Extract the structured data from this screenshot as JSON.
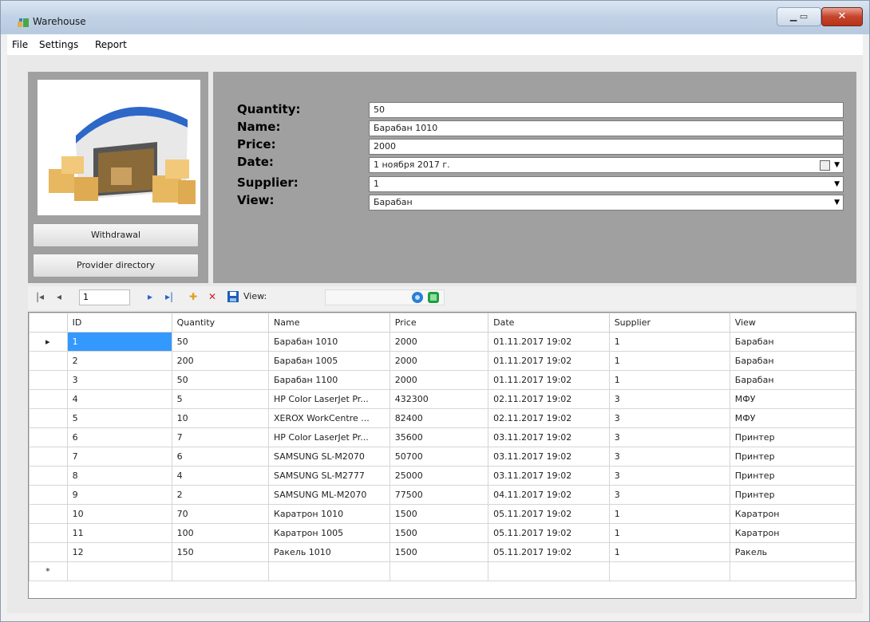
{
  "window": {
    "title": "Warehouse"
  },
  "menu": [
    "File",
    "Settings",
    "Report"
  ],
  "side_buttons": {
    "withdrawal": "Withdrawal",
    "provider_directory": "Provider directory"
  },
  "form": {
    "quantity_label": "Quantity:",
    "quantity_value": "50",
    "name_label": "Name:",
    "name_value": "Барабан 1010",
    "price_label": "Price:",
    "price_value": "2000",
    "date_label": "Date:",
    "date_value": "1  ноября  2017 г.",
    "supplier_label": "Supplier:",
    "supplier_value": "1",
    "view_label": "View:",
    "view_value": "Барабан"
  },
  "toolbar": {
    "position": "1",
    "view_label": "View:"
  },
  "grid": {
    "columns": [
      "ID",
      "Quantity",
      "Name",
      "Price",
      "Date",
      "Supplier",
      "View"
    ],
    "rows": [
      [
        "1",
        "50",
        "Барабан 1010",
        "2000",
        "01.11.2017 19:02",
        "1",
        "Барабан"
      ],
      [
        "2",
        "200",
        "Барабан 1005",
        "2000",
        "01.11.2017 19:02",
        "1",
        "Барабан"
      ],
      [
        "3",
        "50",
        "Барабан 1100",
        "2000",
        "01.11.2017 19:02",
        "1",
        "Барабан"
      ],
      [
        "4",
        "5",
        "HP Color LaserJet Pr...",
        "432300",
        "02.11.2017 19:02",
        "3",
        "МФУ"
      ],
      [
        "5",
        "10",
        "XEROX WorkCentre ...",
        "82400",
        "02.11.2017 19:02",
        "3",
        "МФУ"
      ],
      [
        "6",
        "7",
        "HP Color LaserJet Pr...",
        "35600",
        "03.11.2017 19:02",
        "3",
        "Принтер"
      ],
      [
        "7",
        "6",
        "SAMSUNG SL-M2070",
        "50700",
        "03.11.2017 19:02",
        "3",
        "Принтер"
      ],
      [
        "8",
        "4",
        "SAMSUNG SL-M2777",
        "25000",
        "03.11.2017 19:02",
        "3",
        "Принтер"
      ],
      [
        "9",
        "2",
        "SAMSUNG ML-M2070",
        "77500",
        "04.11.2017 19:02",
        "3",
        "Принтер"
      ],
      [
        "10",
        "70",
        "Каратрон 1010",
        "1500",
        "05.11.2017 19:02",
        "1",
        "Каратрон"
      ],
      [
        "11",
        "100",
        "Каратрон 1005",
        "1500",
        "05.11.2017 19:02",
        "1",
        "Каратрон"
      ],
      [
        "12",
        "150",
        "Ракель 1010",
        "1500",
        "05.11.2017 19:02",
        "1",
        "Ракель"
      ]
    ],
    "current_marker": "▸",
    "new_row_marker": "*"
  }
}
